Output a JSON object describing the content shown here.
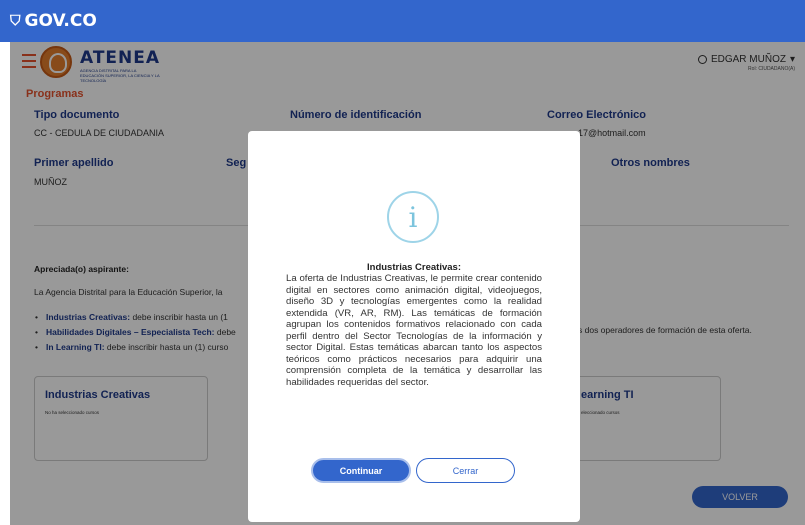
{
  "gov": {
    "logo_text": "GOV.CO"
  },
  "brand": {
    "name": "ATENEA",
    "subtitle": "AGENCIA DISTRITAL PARA LA EDUCACIÓN SUPERIOR, LA CIENCIA Y LA TECNOLOGÍA"
  },
  "user": {
    "name": "EDGAR MUÑOZ",
    "role": "Rol: CIUDADANO(A)",
    "caret": "▾"
  },
  "section": {
    "title": "Programas"
  },
  "fields": {
    "tipo_documento": {
      "label": "Tipo documento",
      "value": "CC - CEDULA DE CIUDADANIA"
    },
    "numero_identificacion": {
      "label": "Número de identificación",
      "value": ""
    },
    "correo": {
      "label": "Correo Electrónico",
      "value": "17@hotmail.com"
    },
    "primer_apellido": {
      "label": "Primer apellido",
      "value": "MUÑOZ"
    },
    "segundo_apellido": {
      "label": "Seg"
    },
    "otros_nombres": {
      "label": "Otros nombres"
    }
  },
  "intro": {
    "title": "Apreciada(o) aspirante:",
    "text": "La Agencia Distrital para la Educación Superior, la",
    "bullets": [
      {
        "bold": "Industrias Creativas:",
        "text": " debe inscribir hasta un (1"
      },
      {
        "bold": "Habilidades Digitales – Especialista Tech:",
        "text": " debe"
      },
      {
        "bold": "In Learning TI:",
        "text": " debe inscribir hasta un (1) curso"
      }
    ],
    "right_text": "s dos operadores de formación de esta oferta."
  },
  "cards": [
    {
      "title": "Industrias Creativas",
      "sub": "No ha seleccionado cursos"
    },
    {
      "title": "earning TI",
      "sub": "eleccionado cursos"
    }
  ],
  "volver_label": "VOLVER",
  "modal": {
    "icon": "i",
    "title": "Industrias Creativas:",
    "body": "La oferta de Industrias Creativas, le permite crear contenido digital en sectores como animación digital, videojuegos, diseño 3D y tecnologías emergentes como la realidad extendida (VR, AR, RM). Las temáticas de formación agrupan los contenidos formativos relacionado con cada perfil dentro del Sector Tecnologías de la información y sector Digital. Estas temáticas abarcan tanto los aspectos teóricos como prácticos necesarios para adquirir una comprensión completa de la temática y desarrollar las habilidades requeridas del sector.",
    "continuar_label": "Continuar",
    "cerrar_label": "Cerrar"
  }
}
